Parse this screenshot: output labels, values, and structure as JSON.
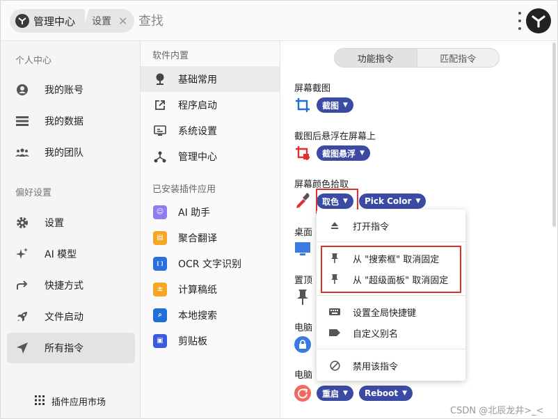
{
  "header": {
    "breadcrumb": {
      "home_label": "管理中心",
      "current_label": "设置"
    },
    "search_placeholder": "查找"
  },
  "sidebar": {
    "personal_title": "个人中心",
    "personal_items": [
      {
        "label": "我的账号",
        "icon": "account-icon"
      },
      {
        "label": "我的数据",
        "icon": "data-icon"
      },
      {
        "label": "我的团队",
        "icon": "team-icon"
      }
    ],
    "pref_title": "偏好设置",
    "pref_items": [
      {
        "label": "设置",
        "icon": "gear-icon"
      },
      {
        "label": "AI 模型",
        "icon": "sparkle-icon"
      },
      {
        "label": "快捷方式",
        "icon": "shortcut-icon"
      },
      {
        "label": "文件启动",
        "icon": "rocket-icon"
      },
      {
        "label": "所有指令",
        "icon": "navigation-icon",
        "active": true
      }
    ],
    "market_label": "插件应用市场"
  },
  "middle": {
    "builtin_title": "软件内置",
    "builtin_items": [
      {
        "label": "基础常用",
        "active": true
      },
      {
        "label": "程序启动"
      },
      {
        "label": "系统设置"
      },
      {
        "label": "管理中心"
      }
    ],
    "installed_title": "已安装插件应用",
    "installed_items": [
      {
        "label": "AI 助手",
        "color": "#8e7cf0"
      },
      {
        "label": "聚合翻译",
        "color": "#f5a623"
      },
      {
        "label": "OCR 文字识别",
        "color": "#2a6fdb"
      },
      {
        "label": "计算稿纸",
        "color": "#f5a623"
      },
      {
        "label": "本地搜索",
        "color": "#1f6fd6"
      },
      {
        "label": "剪贴板",
        "color": "#3b5bdb"
      }
    ]
  },
  "content": {
    "tabs": [
      "功能指令",
      "匹配指令"
    ],
    "features": [
      {
        "title": "屏幕截图",
        "chips": [
          "截图"
        ]
      },
      {
        "title": "截图后悬浮在屏幕上",
        "chips": [
          "截图悬浮"
        ]
      },
      {
        "title": "屏幕颜色拾取",
        "chips": [
          "取色",
          "Pick Color"
        ]
      },
      {
        "title": "桌面",
        "chips": []
      },
      {
        "title": "置顶",
        "chips": []
      },
      {
        "title": "电脑",
        "chips": []
      },
      {
        "title": "电脑",
        "chips": [
          "重启",
          "Reboot"
        ]
      }
    ]
  },
  "menu": {
    "items": [
      {
        "label": "打开指令",
        "icon": "eject-icon"
      },
      {
        "label": "从 \"搜索框\" 取消固定",
        "icon": "pin-icon"
      },
      {
        "label": "从 \"超级面板\" 取消固定",
        "icon": "pin-icon"
      },
      {
        "label": "设置全局快捷键",
        "icon": "keyboard-icon"
      },
      {
        "label": "自定义别名",
        "icon": "tag-icon"
      },
      {
        "label": "禁用该指令",
        "icon": "block-icon"
      }
    ]
  },
  "watermark": "CSDN @北辰龙井>_<",
  "colors": {
    "accent": "#3b4aa3",
    "highlight_box": "#e0302f"
  }
}
